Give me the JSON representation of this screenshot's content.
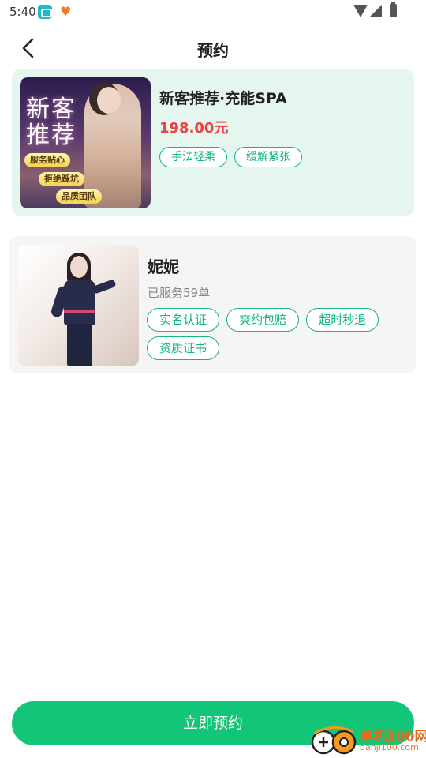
{
  "status_bar": {
    "time": "5:40",
    "icons": [
      "app-notification-icon",
      "heart-app-icon",
      "wifi-icon",
      "signal-icon",
      "battery-icon"
    ]
  },
  "header": {
    "title": "预约",
    "back_icon": "chevron-left-icon"
  },
  "product": {
    "image_text": {
      "title": "新客推荐",
      "tags": [
        "服务贴心",
        "拒绝踩坑",
        "品质团队"
      ]
    },
    "name": "新客推荐·充能SPA",
    "price": "198.00元",
    "tags": [
      "手法轻柔",
      "缓解紧张"
    ]
  },
  "technician": {
    "name": "妮妮",
    "served": "已服务59单",
    "tags": [
      "实名认证",
      "爽约包赔",
      "超时秒退",
      "资质证书"
    ]
  },
  "footer": {
    "book_label": "立即预约"
  },
  "watermark": {
    "text": "单机100网",
    "sub": "danji100.com"
  },
  "colors": {
    "accent": "#13c677",
    "tag_green": "#13b77a",
    "price_red": "#ee4141",
    "product_card_bg": "#e5f6ee",
    "tech_card_bg": "#f5f5f5"
  }
}
